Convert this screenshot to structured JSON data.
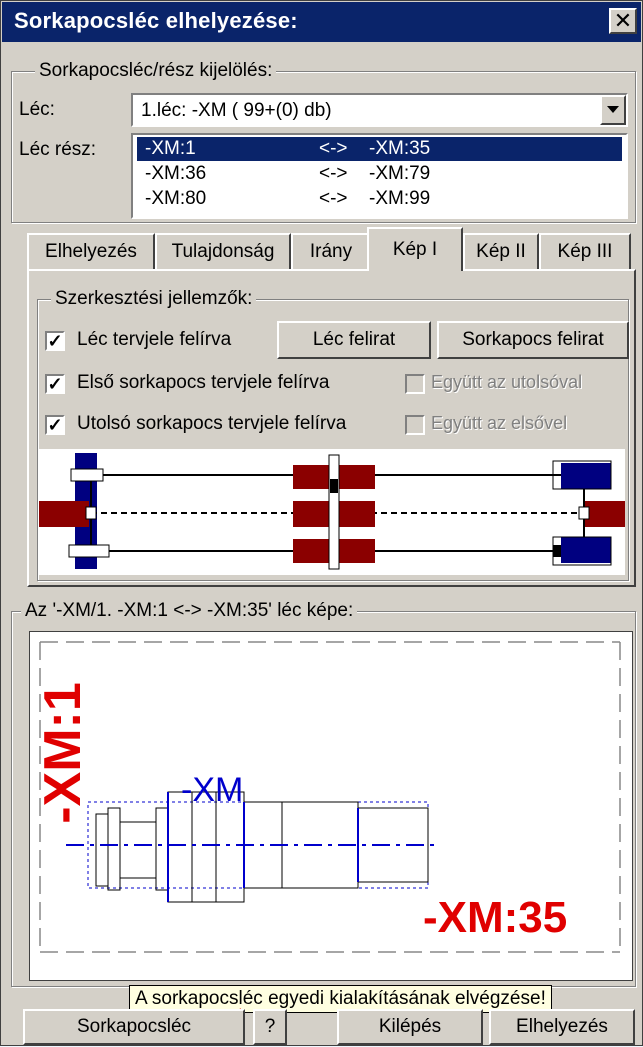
{
  "window": {
    "title": "Sorkapocsléc elhelyezése:",
    "close": "✕"
  },
  "selection": {
    "group_label": "Sorkapocsléc/rész kijelölés:",
    "lec_label": "Léc:",
    "lec_value": "1.léc:  -XM ( 99+(0) db)",
    "lecresz_label": "Léc rész:",
    "rows": [
      {
        "from": "-XM:1",
        "sep": "<->",
        "to": "-XM:35"
      },
      {
        "from": "-XM:36",
        "sep": "<->",
        "to": "-XM:79"
      },
      {
        "from": "-XM:80",
        "sep": "<->",
        "to": "-XM:99"
      }
    ]
  },
  "tabs": [
    "Elhelyezés",
    "Tulajdonság",
    "Irány",
    "Kép I",
    "Kép II",
    "Kép III"
  ],
  "active_tab": "Kép I",
  "props": {
    "group_label": "Szerkesztési jellemzők:",
    "cb1": "Léc tervjele felírva",
    "cb2": "Első sorkapocs tervjele felírva",
    "cb3": "Utolsó sorkapocs tervjele felírva",
    "btn_lec": "Léc felirat",
    "btn_sorkapocs": "Sorkapocs felirat",
    "dis1": "Együtt az utolsóval",
    "dis2": "Együtt az elsővel"
  },
  "preview": {
    "group_label": "Az '-XM/1. -XM:1 <-> -XM:35' léc képe:",
    "top_label": "-XM:1",
    "mid_label": "-XM",
    "bottom_label": "-XM:35"
  },
  "tooltip": "A sorkapocsléc egyedi kialakításának elvégzése!",
  "buttons": {
    "sorkapocsleс": "Sorkapocsléc",
    "help": "?",
    "exit": "Kilépés",
    "place": "Elhelyezés"
  },
  "colors": {
    "titlebar": "#0a246a",
    "dark_red": "#8b0000",
    "navy": "#00008b",
    "red": "#e00000",
    "blue": "#0000cc"
  }
}
